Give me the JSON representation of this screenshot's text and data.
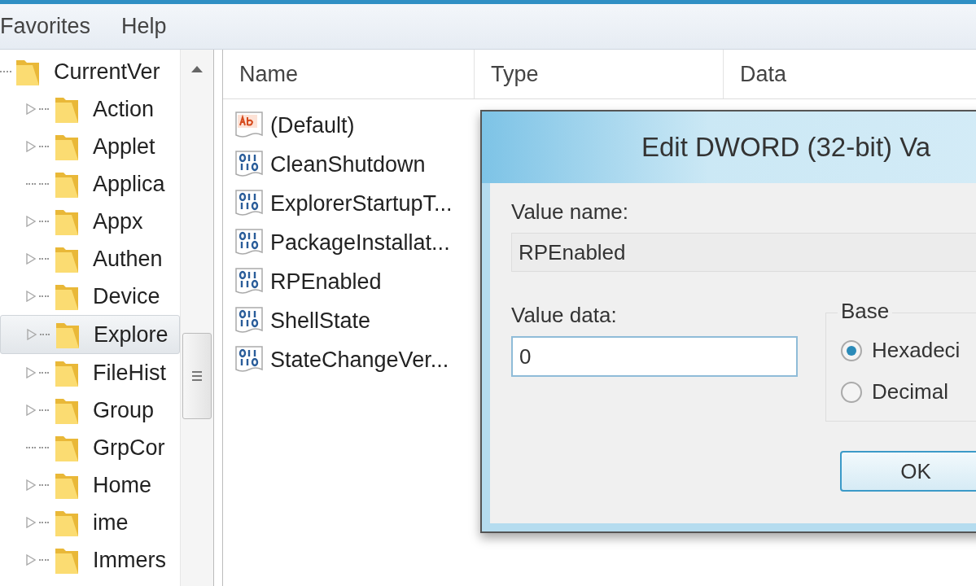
{
  "menu": [
    {
      "label": "Favorites"
    },
    {
      "label": "Help"
    }
  ],
  "tree": {
    "label": "CurrentVer",
    "expanded": true,
    "selected": false,
    "children": [
      {
        "label": "Action",
        "expandable": true,
        "selected": false
      },
      {
        "label": "Applet",
        "expandable": true,
        "selected": false
      },
      {
        "label": "Applica",
        "expandable": false,
        "selected": false
      },
      {
        "label": "Appx",
        "expandable": true,
        "selected": false
      },
      {
        "label": "Authen",
        "expandable": true,
        "selected": false
      },
      {
        "label": "Device",
        "expandable": true,
        "selected": false
      },
      {
        "label": "Explore",
        "expandable": true,
        "selected": true
      },
      {
        "label": "FileHist",
        "expandable": true,
        "selected": false
      },
      {
        "label": "Group",
        "expandable": true,
        "selected": false
      },
      {
        "label": "GrpCor",
        "expandable": false,
        "selected": false
      },
      {
        "label": "Home",
        "expandable": true,
        "selected": false
      },
      {
        "label": "ime",
        "expandable": true,
        "selected": false
      },
      {
        "label": "Immers",
        "expandable": true,
        "selected": false
      }
    ]
  },
  "table": {
    "columns": [
      "Name",
      "Type",
      "Data"
    ],
    "rows": [
      {
        "kind": "string",
        "name": "(Default)"
      },
      {
        "kind": "dword",
        "name": "CleanShutdown"
      },
      {
        "kind": "dword",
        "name": "ExplorerStartupT..."
      },
      {
        "kind": "dword",
        "name": "PackageInstallat..."
      },
      {
        "kind": "dword",
        "name": "RPEnabled"
      },
      {
        "kind": "dword",
        "name": "ShellState"
      },
      {
        "kind": "dword",
        "name": "StateChangeVer..."
      }
    ]
  },
  "dialog": {
    "title": "Edit DWORD (32-bit) Va",
    "value_name_label": "Value name:",
    "value_name": "RPEnabled",
    "value_data_label": "Value data:",
    "value_data": "0",
    "base": {
      "label": "Base",
      "options": [
        {
          "label": "Hexadeci",
          "selected": true
        },
        {
          "label": "Decimal",
          "selected": false
        }
      ]
    },
    "buttons": [
      "OK"
    ]
  }
}
